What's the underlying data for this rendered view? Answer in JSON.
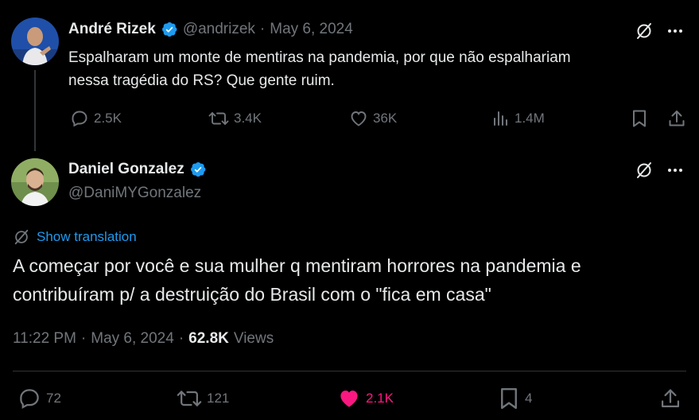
{
  "colors": {
    "background": "#000000",
    "text": "#e7e9ea",
    "muted": "#71767b",
    "accent": "#1d9bf0",
    "like": "#f91880",
    "verified": "#1d9bf0"
  },
  "parent_tweet": {
    "author_name": "André Rizek",
    "handle": "@andrizek",
    "separator": "·",
    "date": "May 6, 2024",
    "verified": true,
    "text_line1": "Espalharam um monte de mentiras na pandemia, por que não espalhariam",
    "text_line2": "nessa tragédia do RS? Que gente ruim.",
    "actions": {
      "replies": "2.5K",
      "reposts": "3.4K",
      "likes": "36K",
      "views": "1.4M"
    },
    "icons": [
      "grok-icon",
      "more-icon",
      "reply-icon",
      "repost-icon",
      "like-icon",
      "views-icon",
      "bookmark-icon",
      "share-icon"
    ]
  },
  "main_tweet": {
    "author_name": "Daniel Gonzalez",
    "handle": "@DaniMYGonzalez",
    "verified": true,
    "translate_label": "Show translation",
    "text_line1": "A começar por você e sua mulher q mentiram horrores na pandemia e",
    "text_line2": "contribuíram p/ a destruição do Brasil com o \"fica em casa\"",
    "time": "11:22 PM",
    "separator": "·",
    "date": "May 6, 2024",
    "separator2": "·",
    "views_count": "62.8K",
    "views_label": "Views",
    "actions": {
      "replies": "72",
      "reposts": "121",
      "likes": "2.1K",
      "bookmarks": "4"
    }
  }
}
